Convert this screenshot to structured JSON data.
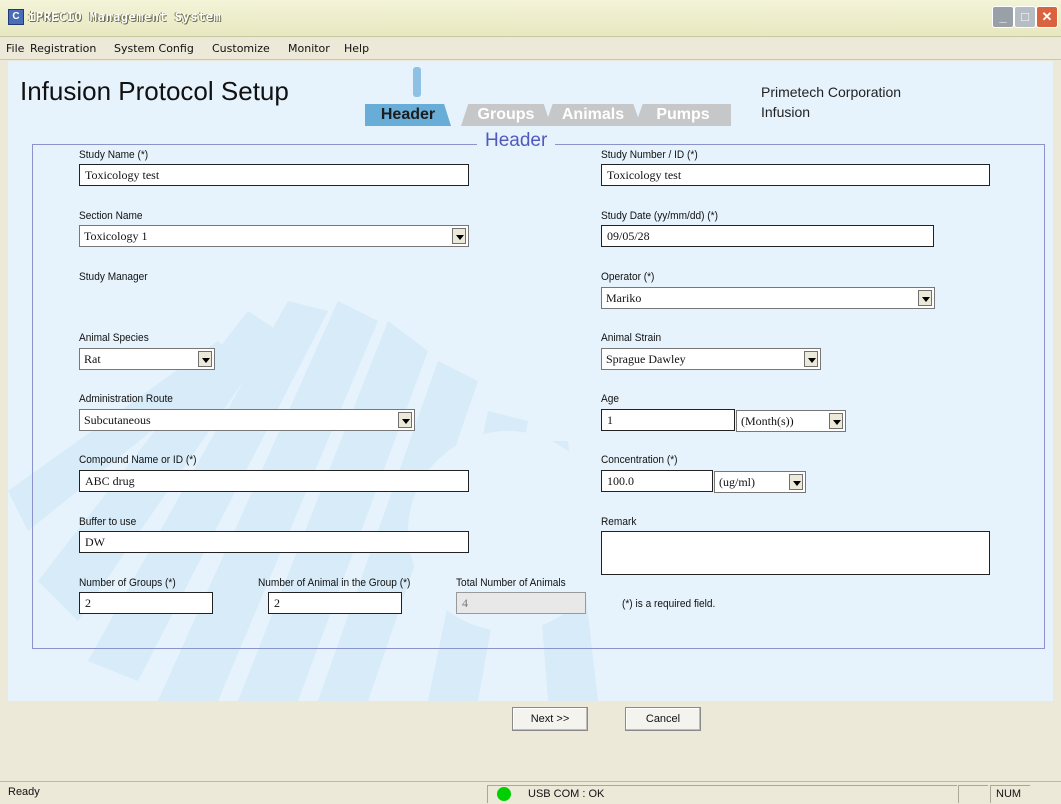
{
  "window": {
    "title": "iPRECIO Management System"
  },
  "menu": [
    "File",
    "Registration",
    "System Config",
    "Customize",
    "Monitor",
    "Help"
  ],
  "page": {
    "title": "Infusion Protocol Setup",
    "company": "Primetech Corporation",
    "mode": "Infusion"
  },
  "tabs": [
    "Header",
    "Groups",
    "Animals",
    "Pumps"
  ],
  "panel_title": "Header",
  "fields": {
    "study_name": {
      "label": "Study Name (*)",
      "value": "Toxicology test"
    },
    "study_number": {
      "label": "Study Number / ID (*)",
      "value": "Toxicology test"
    },
    "section_name": {
      "label": "Section Name",
      "value": "Toxicology 1"
    },
    "study_date": {
      "label": "Study Date (yy/mm/dd) (*)",
      "value": "09/05/28"
    },
    "study_manager": {
      "label": "Study Manager"
    },
    "operator": {
      "label": "Operator (*)",
      "value": "Mariko"
    },
    "animal_species": {
      "label": "Animal Species",
      "value": "Rat"
    },
    "animal_strain": {
      "label": "Animal Strain",
      "value": "Sprague Dawley"
    },
    "admin_route": {
      "label": "Administration Route",
      "value": "Subcutaneous"
    },
    "age": {
      "label": "Age",
      "value": "1",
      "unit": "(Month(s))"
    },
    "compound": {
      "label": "Compound Name or ID (*)",
      "value": "ABC drug"
    },
    "concentration": {
      "label": "Concentration (*)",
      "value": "100.0",
      "unit": "(ug/ml)"
    },
    "buffer": {
      "label": "Buffer to use",
      "value": "DW"
    },
    "remark": {
      "label": "Remark",
      "value": ""
    },
    "num_groups": {
      "label": "Number of Groups (*)",
      "value": "2"
    },
    "num_animals_group": {
      "label": "Number of Animal in the Group (*)",
      "value": "2"
    },
    "total_animals": {
      "label": "Total Number of Animals",
      "value": "4"
    }
  },
  "required_note": "(*) is a required field.",
  "buttons": {
    "next": "Next >>",
    "cancel": "Cancel"
  },
  "status": {
    "ready": "Ready",
    "usb": "USB COM : OK",
    "num": "NUM"
  },
  "colors": {
    "accent": "#5159bf",
    "tab_active": "#67add8",
    "led": "#00d000"
  }
}
